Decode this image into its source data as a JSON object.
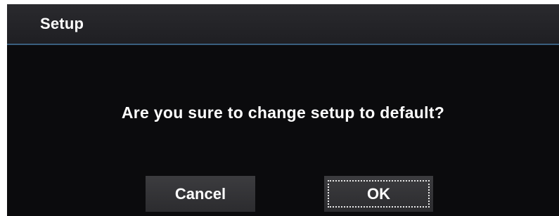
{
  "dialog": {
    "title": "Setup",
    "message": "Are you sure to change setup to default?",
    "buttons": {
      "cancel_label": "Cancel",
      "ok_label": "OK"
    },
    "focused_button": "ok"
  },
  "colors": {
    "background": "#0b0b0d",
    "title_bar": "#242428",
    "title_divider": "#3a5f7e",
    "button": "#343437",
    "text": "#ffffff"
  }
}
